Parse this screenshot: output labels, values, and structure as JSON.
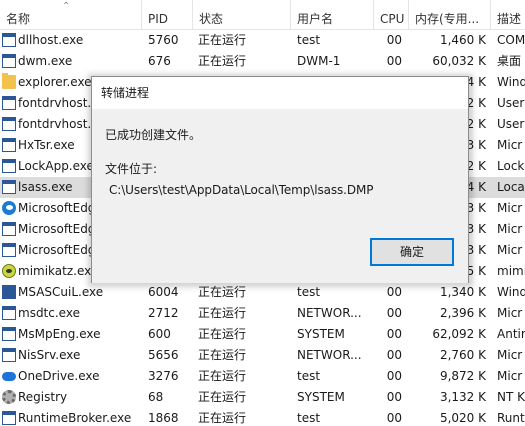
{
  "table": {
    "columns": {
      "name": "名称",
      "pid": "PID",
      "status": "状态",
      "user": "用户名",
      "cpu": "CPU",
      "mem": "内存(专用...",
      "desc": "描述"
    },
    "rows": [
      {
        "icon": "window-icon",
        "name": "dllhost.exe",
        "pid": "5760",
        "status": "正在运行",
        "user": "test",
        "cpu": "00",
        "mem": "1,460 K",
        "desc": "COM"
      },
      {
        "icon": "window-icon",
        "name": "dwm.exe",
        "pid": "676",
        "status": "正在运行",
        "user": "DWM-1",
        "cpu": "00",
        "mem": "60,032 K",
        "desc": "桌面"
      },
      {
        "icon": "folder-icon",
        "name": "explorer.exe",
        "pid": "",
        "status": "",
        "user": "",
        "cpu": "",
        "mem": "4 K",
        "desc": "Wind"
      },
      {
        "icon": "window-icon",
        "name": "fontdrvhost.exe",
        "pid": "",
        "status": "",
        "user": "",
        "cpu": "",
        "mem": "2 K",
        "desc": "User"
      },
      {
        "icon": "window-icon",
        "name": "fontdrvhost.exe",
        "pid": "",
        "status": "",
        "user": "",
        "cpu": "",
        "mem": "2 K",
        "desc": "User"
      },
      {
        "icon": "window-icon",
        "name": "HxTsr.exe",
        "pid": "",
        "status": "",
        "user": "",
        "cpu": "",
        "mem": "3 K",
        "desc": "Micr"
      },
      {
        "icon": "window-icon",
        "name": "LockApp.exe",
        "pid": "",
        "status": "",
        "user": "",
        "cpu": "",
        "mem": "2 K",
        "desc": "Lock"
      },
      {
        "icon": "window-icon",
        "name": "lsass.exe",
        "pid": "",
        "status": "",
        "user": "",
        "cpu": "",
        "mem": "4 K",
        "desc": "Loca",
        "selected": true
      },
      {
        "icon": "edge-icon",
        "name": "MicrosoftEdge.exe",
        "pid": "",
        "status": "",
        "user": "",
        "cpu": "",
        "mem": "3 K",
        "desc": "Micr"
      },
      {
        "icon": "window-icon",
        "name": "MicrosoftEdgeCP.exe",
        "pid": "",
        "status": "",
        "user": "",
        "cpu": "",
        "mem": "3 K",
        "desc": "Micr"
      },
      {
        "icon": "window-icon",
        "name": "MicrosoftEdgeSH.exe",
        "pid": "",
        "status": "",
        "user": "",
        "cpu": "",
        "mem": "3 K",
        "desc": "Micr"
      },
      {
        "icon": "mimikatz-icon",
        "name": "mimikatz.exe",
        "pid": "",
        "status": "",
        "user": "",
        "cpu": "",
        "mem": "5 K",
        "desc": "mimi"
      },
      {
        "icon": "window-icon",
        "name": "MSASCuiL.exe",
        "pid": "6004",
        "status": "正在运行",
        "user": "test",
        "cpu": "00",
        "mem": "1,340 K",
        "desc": "Wind"
      },
      {
        "icon": "window-icon",
        "name": "msdtc.exe",
        "pid": "2712",
        "status": "正在运行",
        "user": "NETWOR...",
        "cpu": "00",
        "mem": "2,396 K",
        "desc": "Micr"
      },
      {
        "icon": "window-icon",
        "name": "MsMpEng.exe",
        "pid": "600",
        "status": "正在运行",
        "user": "SYSTEM",
        "cpu": "00",
        "mem": "62,092 K",
        "desc": "Antir"
      },
      {
        "icon": "window-icon",
        "name": "NisSrv.exe",
        "pid": "5656",
        "status": "正在运行",
        "user": "NETWOR...",
        "cpu": "00",
        "mem": "2,760 K",
        "desc": "Micr"
      },
      {
        "icon": "cloud-icon",
        "name": "OneDrive.exe",
        "pid": "3276",
        "status": "正在运行",
        "user": "test",
        "cpu": "00",
        "mem": "9,872 K",
        "desc": "Micr"
      },
      {
        "icon": "gear-icon",
        "name": "Registry",
        "pid": "68",
        "status": "正在运行",
        "user": "SYSTEM",
        "cpu": "00",
        "mem": "3,132 K",
        "desc": "NT K"
      },
      {
        "icon": "window-icon",
        "name": "RuntimeBroker.exe",
        "pid": "1868",
        "status": "正在运行",
        "user": "test",
        "cpu": "00",
        "mem": "5,020 K",
        "desc": "Runt"
      }
    ]
  },
  "dialog": {
    "title": "转储进程",
    "message": "已成功创建文件。",
    "location_label": "文件位于:",
    "location_path": "C:\\Users\\test\\AppData\\Local\\Temp\\lsass.DMP",
    "ok_label": "确定"
  },
  "colors": {
    "accent": "#0078d7",
    "selected_row": "#dcdcdc",
    "dialog_body": "#f0f0f0"
  }
}
